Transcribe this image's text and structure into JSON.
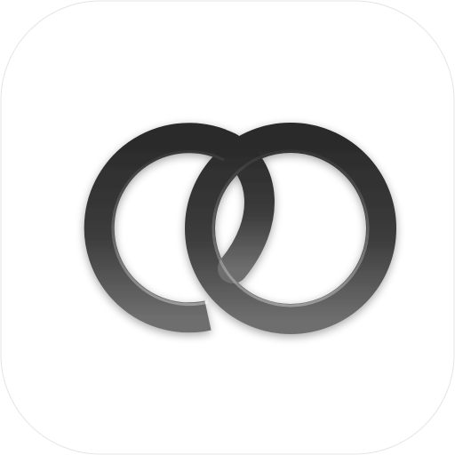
{
  "icon": {
    "name": "interlocking-rings-icon",
    "background_color": "#ffffff",
    "tile_border_color": "#e4e4e4",
    "ring_color_top": "#2a2a2a",
    "ring_color_bottom": "#6e6e6e",
    "ring_highlight_color": "#a8a8a8"
  }
}
